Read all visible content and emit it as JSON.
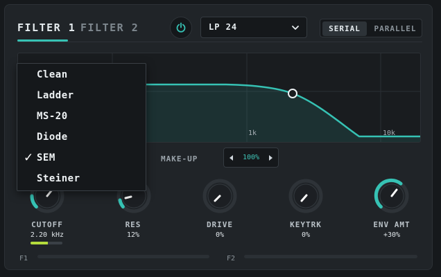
{
  "header": {
    "tabs": [
      {
        "label": "FILTER 1",
        "active": true
      },
      {
        "label": "FILTER 2",
        "active": false
      }
    ],
    "power_icon": "power-icon",
    "filter_type": "LP 24",
    "routing": {
      "options": [
        "SERIAL",
        "PARALLEL"
      ],
      "selected": "SERIAL"
    }
  },
  "graph": {
    "freq_labels": [
      "1k",
      "10k"
    ],
    "accent": "#36c2b4"
  },
  "makeup": {
    "label": "MAKE-UP",
    "value": "100%"
  },
  "knobs": [
    {
      "id": "cutoff",
      "label": "CUTOFF",
      "value": "2.20 kHz"
    },
    {
      "id": "res",
      "label": "RES",
      "value": "12%"
    },
    {
      "id": "drive",
      "label": "DRIVE",
      "value": "0%"
    },
    {
      "id": "keytrk",
      "label": "KEYTRK",
      "value": "0%"
    },
    {
      "id": "envamt",
      "label": "ENV AMT",
      "value": "+30%"
    }
  ],
  "cutoff_meter": {
    "level": 0.55,
    "color": "#b4dc3c"
  },
  "footer": {
    "f1": "F1",
    "f2": "F2"
  },
  "model_menu": {
    "items": [
      "Clean",
      "Ladder",
      "MS-20",
      "Diode",
      "SEM",
      "Steiner"
    ],
    "selected": "SEM",
    "check_glyph": "✓"
  }
}
